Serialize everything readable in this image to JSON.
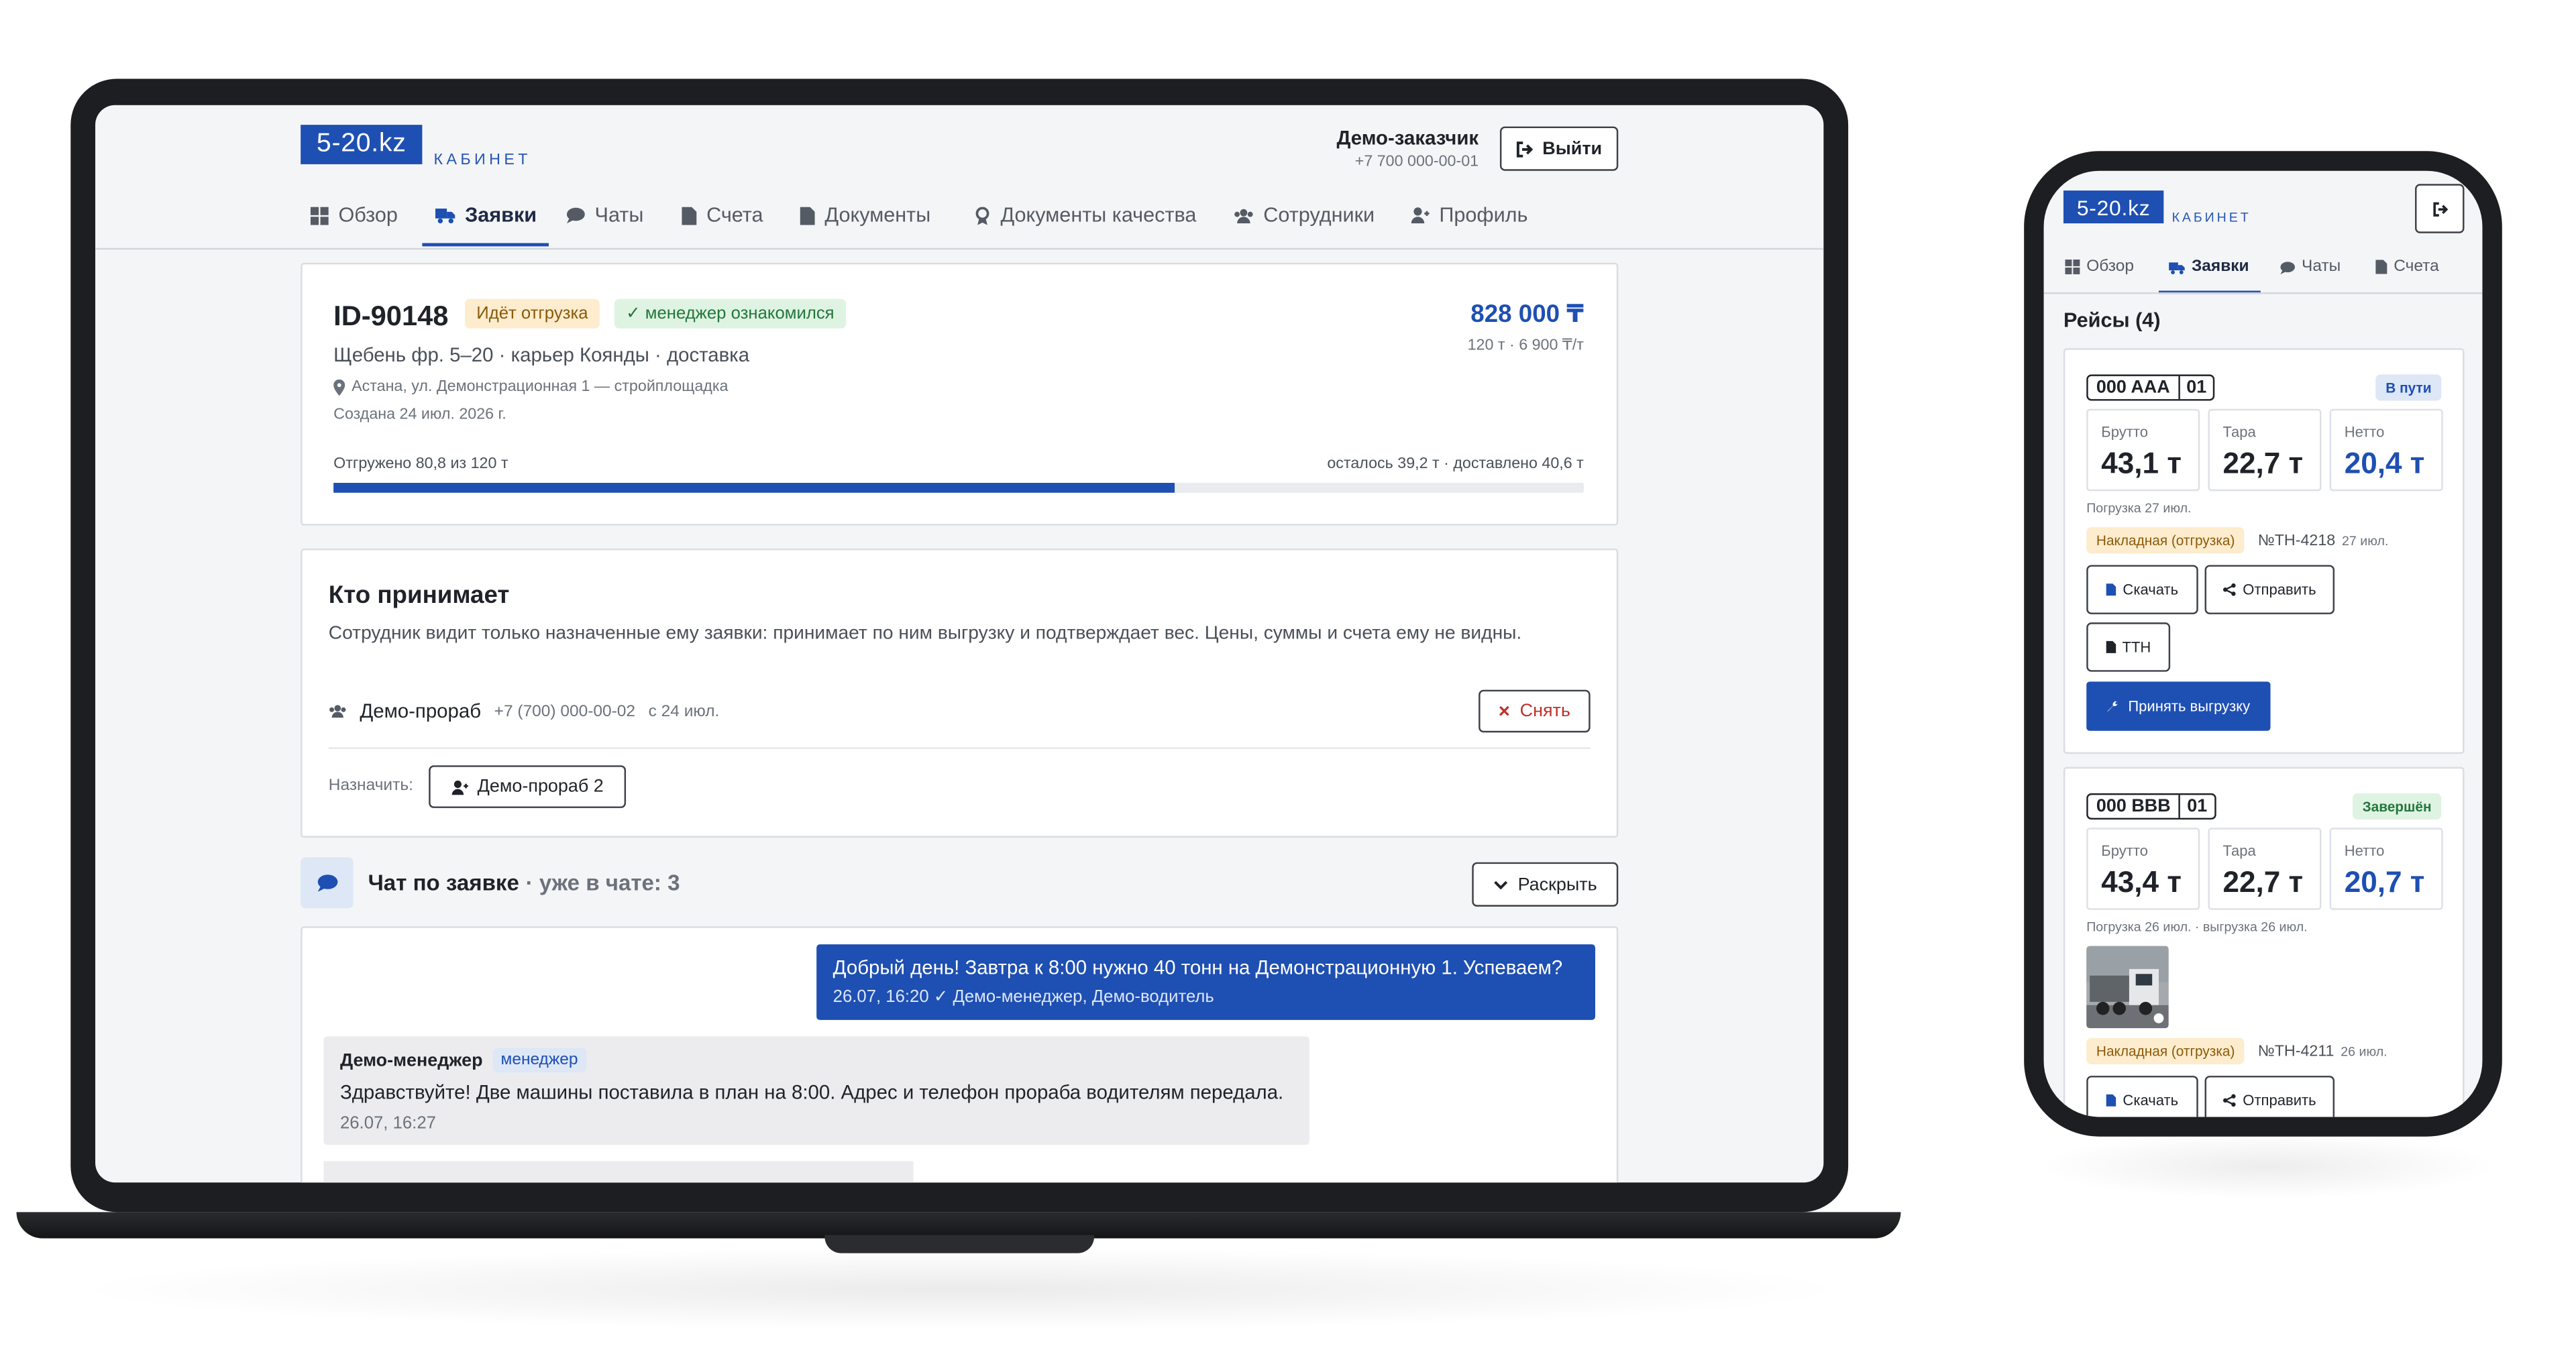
{
  "brand": {
    "logo": "5-20.kz",
    "cabinet": "КАБИНЕТ"
  },
  "header": {
    "user_name": "Демо-заказчик",
    "user_phone": "+7 700 000-00-01",
    "logout_label": "Выйти"
  },
  "nav": {
    "tabs": [
      {
        "label": "Обзор",
        "icon": "grid-icon"
      },
      {
        "label": "Заявки",
        "icon": "truck-icon",
        "active": true
      },
      {
        "label": "Чаты",
        "icon": "chat-icon"
      },
      {
        "label": "Счета",
        "icon": "file-icon"
      },
      {
        "label": "Документы",
        "icon": "file-icon"
      },
      {
        "label": "Документы качества",
        "icon": "award-icon"
      },
      {
        "label": "Сотрудники",
        "icon": "users-icon"
      },
      {
        "label": "Профиль",
        "icon": "user-icon"
      }
    ]
  },
  "order": {
    "id": "ID-90148",
    "status_badge": "Идёт отгрузка",
    "ack_badge": "✓ менеджер ознакомился",
    "total": "828 000 ₸",
    "total_detail": "120 т · 6 900 ₸/т",
    "title": "Щебень фр. 5–20 · карьер Коянды · доставка",
    "address": "Астана, ул. Демонстрационная 1 — стройплощадка",
    "created": "Создана 24 июл. 2026 г.",
    "progress_left": "Отгружено 80,8 из 120 т",
    "progress_right": "осталось 39,2 т · доставлено 40,6 т",
    "progress_fraction": 0.673
  },
  "receiver": {
    "title": "Кто принимает",
    "description": "Сотрудник видит только назначенные ему заявки: принимает по ним выгрузку и подтверждает вес. Цены, суммы и счета ему не видны.",
    "name": "Демо-прораб",
    "phone": "+7 (700) 000-00-02",
    "since": "с 24 июл.",
    "remove_label": "Снять",
    "assign_label": "Назначить:",
    "assign_button": "Демо-прораб 2"
  },
  "chat": {
    "title": "Чат по заявке",
    "members": "· уже в чате: 3",
    "expand_label": "Раскрыть",
    "msg1_text": "Добрый день! Завтра к 8:00 нужно 40 тонн на Демонстрационную 1. Успеваем?",
    "msg1_meta": "26.07, 16:20 ✓ Демо-менеджер, Демо-водитель",
    "msg2_author": "Демо-менеджер",
    "msg2_role": "менеджер",
    "msg2_text": "Здравствуйте! Две машины поставила в план на 8:00. Адрес и телефон прораба водителям передала.",
    "msg2_time": "26.07, 16:27"
  },
  "mobile": {
    "tabs": [
      "Обзор",
      "Заявки",
      "Чаты",
      "Счета"
    ],
    "trips_title": "Рейсы (4)",
    "trip1": {
      "plate_main": "000 AAA",
      "plate_region": "01",
      "status": "В пути",
      "gross_label": "Брутто",
      "gross": "43,1 т",
      "tare_label": "Тара",
      "tare": "22,7 т",
      "net_label": "Нетто",
      "net": "20,4 т",
      "dates": "Погрузка 27 июл.",
      "doc_badge": "Накладная (отгрузка)",
      "doc_no": "№ТН-4218",
      "doc_date": "27 июл.",
      "download": "Скачать",
      "send": "Отправить",
      "ttn": "ТТН",
      "accept": "Принять выгрузку"
    },
    "trip2": {
      "plate_main": "000 BBB",
      "plate_region": "01",
      "status": "Завершён",
      "gross_label": "Брутто",
      "gross": "43,4 т",
      "tare_label": "Тара",
      "tare": "22,7 т",
      "net_label": "Нетто",
      "net": "20,7 т",
      "dates": "Погрузка 26 июл. · выгрузка 26 июл.",
      "doc_badge": "Накладная (отгрузка)",
      "doc_no": "№ТН-4211",
      "doc_date": "26 июл.",
      "download": "Скачать",
      "send": "Отправить"
    }
  },
  "colors": {
    "accent": "#1e4fb2",
    "status_orange": "#fdeccd",
    "status_green": "#dff3e3"
  }
}
